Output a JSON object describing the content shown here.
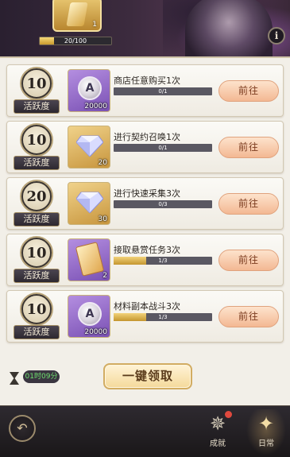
{
  "header": {
    "reward_count": "1",
    "progress_text": "20/100",
    "progress_fraction": 0.2,
    "info_label": "i"
  },
  "tasks": [
    {
      "points": "10",
      "points_label": "活跃度",
      "reward_type": "coin",
      "reward_count": "20000",
      "title": "商店任意购买1次",
      "progress": "0/1",
      "progress_fraction": 0,
      "button": "前往"
    },
    {
      "points": "10",
      "points_label": "活跃度",
      "reward_type": "gem",
      "reward_count": "20",
      "title": "进行契约召唤1次",
      "progress": "0/1",
      "progress_fraction": 0,
      "button": "前往"
    },
    {
      "points": "20",
      "points_label": "活跃度",
      "reward_type": "gem",
      "reward_count": "30",
      "title": "进行快速采集3次",
      "progress": "0/3",
      "progress_fraction": 0,
      "button": "前往"
    },
    {
      "points": "10",
      "points_label": "活跃度",
      "reward_type": "ticket",
      "reward_count": "2",
      "title": "接取悬赏任务3次",
      "progress": "1/3",
      "progress_fraction": 0.333,
      "button": "前往"
    },
    {
      "points": "10",
      "points_label": "活跃度",
      "reward_type": "coin",
      "reward_count": "20000",
      "title": "材料副本战斗3次",
      "progress": "1/3",
      "progress_fraction": 0.333,
      "button": "前往"
    }
  ],
  "timer": "01时09分",
  "claim_all": "一键领取",
  "footer": {
    "back_symbol": "↶",
    "tabs": [
      {
        "label": "成就",
        "icon": "achievement-star-icon",
        "has_notification": true
      },
      {
        "label": "日常",
        "icon": "daily-star-icon",
        "has_notification": false
      }
    ]
  },
  "colors": {
    "accent": "#f3b893",
    "progress_gold": "#c4962f",
    "timer_green": "#6ee06e",
    "notification": "#e0493e"
  }
}
